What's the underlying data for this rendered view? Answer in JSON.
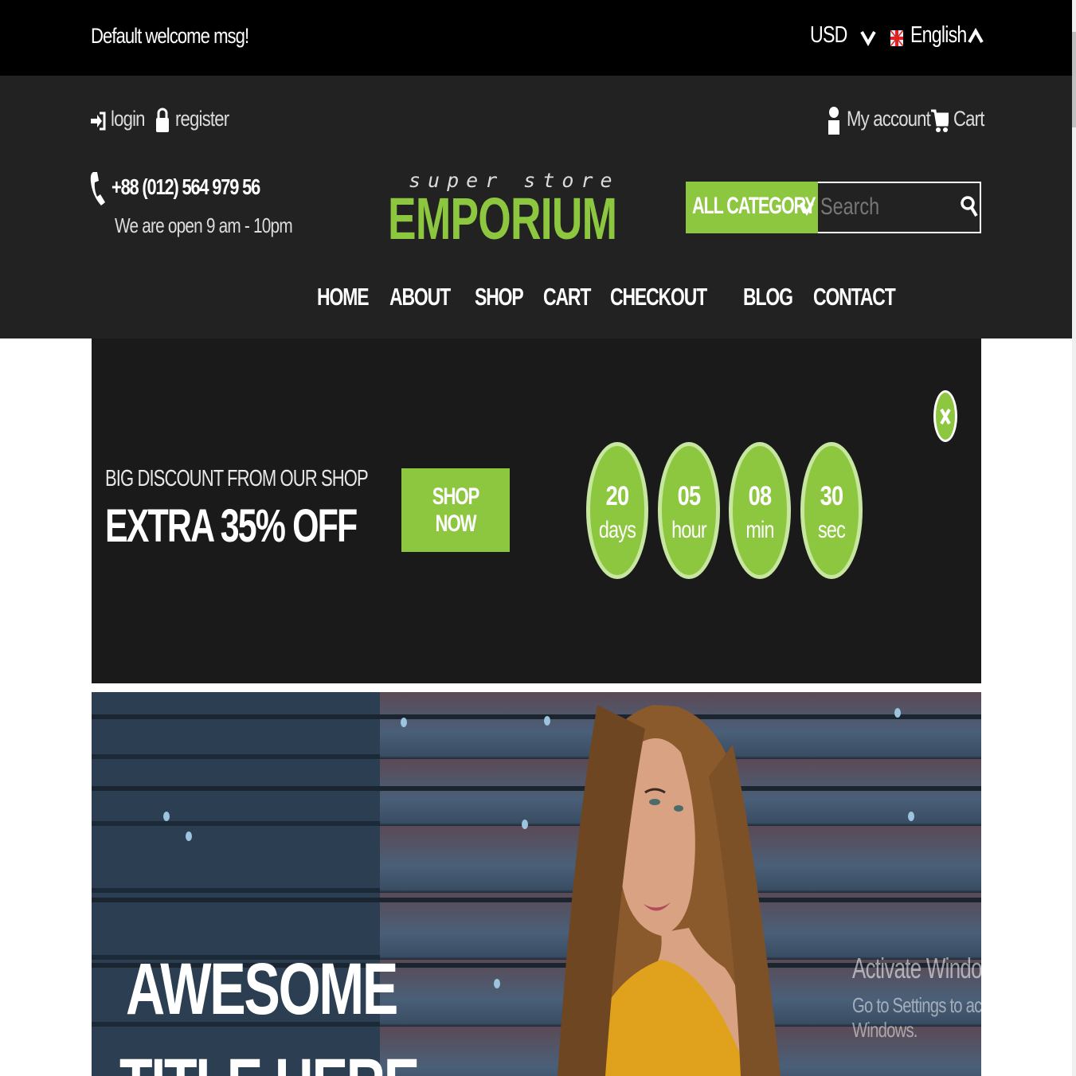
{
  "topbar": {
    "welcome": "Default welcome msg!",
    "currency": "USD",
    "language": "English"
  },
  "header": {
    "login": "login",
    "register": "register",
    "my_account": "My account",
    "cart": "Cart",
    "phone": "+88 (012) 564 979 56",
    "hours": "We are open 9 am - 10pm",
    "logo_tagline": "super store",
    "logo_name": "EMPORIUM",
    "category_label": "ALL CATEGORY",
    "search_placeholder": "Search"
  },
  "nav": {
    "items": [
      "HOME",
      "ABOUT",
      "SHOP",
      "CART",
      "CHECKOUT",
      "BLOG",
      "CONTACT"
    ]
  },
  "promo": {
    "subtitle": "BIG DISCOUNT FROM OUR SHOP",
    "title": "EXTRA 35% OFF",
    "button": "SHOP NOW",
    "countdown": [
      {
        "value": "20",
        "unit": "days"
      },
      {
        "value": "05",
        "unit": "hour"
      },
      {
        "value": "08",
        "unit": "min"
      },
      {
        "value": "30",
        "unit": "sec"
      }
    ]
  },
  "hero": {
    "title_line1": "AWESOME",
    "title_line2": "TITLE HERE"
  },
  "os_overlay": {
    "line1": "Activate Windows",
    "line2": "Go to Settings to activate Windows."
  },
  "colors": {
    "accent": "#8dc63f",
    "topbar_bg": "#000000",
    "header_bg": "#222222",
    "promo_bg": "#1a1a1a"
  }
}
